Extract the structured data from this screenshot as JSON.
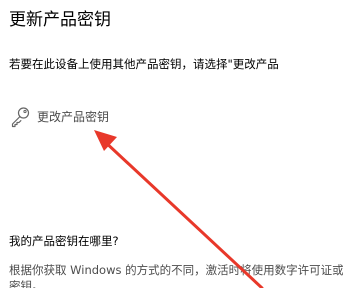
{
  "page": {
    "title": "更新产品密钥",
    "intro": "若要在此设备上使用其他产品密钥，请选择\"更改产品"
  },
  "change_key": {
    "label": "更改产品密钥",
    "icon": "key-icon"
  },
  "where_section": {
    "heading": "我的产品密钥在哪里?",
    "description": "根据你获取 Windows 的方式的不同，激活时将使用数字许可证或产品密钥。"
  },
  "annotation": {
    "arrow_color": "#e8382a"
  }
}
